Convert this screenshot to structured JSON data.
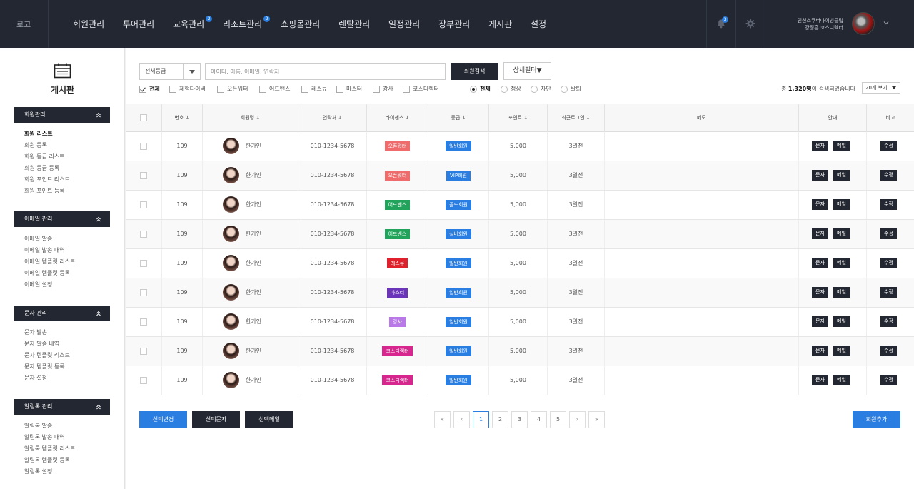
{
  "header": {
    "logo": "로고",
    "nav": [
      {
        "label": "회원관리",
        "badge": ""
      },
      {
        "label": "투어관리",
        "badge": ""
      },
      {
        "label": "교육관리",
        "badge": "2"
      },
      {
        "label": "리조트관리",
        "badge": "2"
      },
      {
        "label": "쇼핑몰관리",
        "badge": ""
      },
      {
        "label": "렌탈관리",
        "badge": ""
      },
      {
        "label": "일정관리",
        "badge": ""
      },
      {
        "label": "장부관리",
        "badge": ""
      },
      {
        "label": "게시판",
        "badge": ""
      },
      {
        "label": "설정",
        "badge": ""
      }
    ],
    "notification_count": "3",
    "profile_line1": "인천스쿠버다이빙클럽",
    "profile_line2": "강정흠 코스디렉터"
  },
  "sidebar": {
    "title": "게시판",
    "sections": [
      {
        "title": "회원관리",
        "items": [
          "회원 리스트",
          "회원 등록",
          "회원 등급 리스트",
          "회원 등급 등록",
          "회원 포인트 리스트",
          "회원 포인트 등록"
        ]
      },
      {
        "title": "이메일 관리",
        "items": [
          "이메일 발송",
          "이메일 발송 내역",
          "이메일 템플릿 리스트",
          "이메일 템플릿 등록",
          "이메일 설정"
        ]
      },
      {
        "title": "문자 관리",
        "items": [
          "문자 발송",
          "문자 발송 내역",
          "문자 템플릿 리스트",
          "문자 템플릿 등록",
          "문자 설정"
        ]
      },
      {
        "title": "알림톡 관리",
        "items": [
          "알림톡 발송",
          "알림톡 발송 내역",
          "알림톡 템플릿 리스트",
          "알림톡 템플릿 등록",
          "알림톡 설정"
        ]
      }
    ]
  },
  "search": {
    "grade_select": "전체등급",
    "placeholder": "아이디, 이름, 이메일, 연락처",
    "search_button": "회원검색",
    "filter_button": "상세필터▼"
  },
  "filters": {
    "licenses": [
      {
        "label": "전체",
        "checked": true
      },
      {
        "label": "체험다이버",
        "checked": false
      },
      {
        "label": "오픈워터",
        "checked": false
      },
      {
        "label": "어드밴스",
        "checked": false
      },
      {
        "label": "레스큐",
        "checked": false
      },
      {
        "label": "마스터",
        "checked": false
      },
      {
        "label": "강사",
        "checked": false
      },
      {
        "label": "코스디렉터",
        "checked": false
      }
    ],
    "statuses": [
      {
        "label": "전체",
        "checked": true
      },
      {
        "label": "정상",
        "checked": false
      },
      {
        "label": "차단",
        "checked": false
      },
      {
        "label": "탈퇴",
        "checked": false
      }
    ]
  },
  "results": {
    "prefix": "총 ",
    "count": "1,320명",
    "suffix": "이 검색되었습니다",
    "page_size": "20개 보기"
  },
  "table": {
    "columns": [
      "번호 ↓",
      "회원명 ↓",
      "연락처 ↓",
      "라이센스 ↓",
      "등급 ↓",
      "포인트 ↓",
      "최근로그인 ↓",
      "메모",
      "안내",
      "비고"
    ],
    "rows": [
      {
        "no": "109",
        "name": "한가인",
        "phone": "010-1234-5678",
        "license": "오픈워터",
        "license_color": "#f06b6b",
        "grade": "일반회원",
        "points": "5,000",
        "last_login": "3일전",
        "memo": ""
      },
      {
        "no": "109",
        "name": "한가인",
        "phone": "010-1234-5678",
        "license": "오픈워터",
        "license_color": "#f06b6b",
        "grade": "VIP회원",
        "points": "5,000",
        "last_login": "3일전",
        "memo": ""
      },
      {
        "no": "109",
        "name": "한가인",
        "phone": "010-1234-5678",
        "license": "어드밴스",
        "license_color": "#22a35c",
        "grade": "골드회원",
        "points": "5,000",
        "last_login": "3일전",
        "memo": ""
      },
      {
        "no": "109",
        "name": "한가인",
        "phone": "010-1234-5678",
        "license": "어드밴스",
        "license_color": "#22a35c",
        "grade": "실버회원",
        "points": "5,000",
        "last_login": "3일전",
        "memo": ""
      },
      {
        "no": "109",
        "name": "한가인",
        "phone": "010-1234-5678",
        "license": "레스큐",
        "license_color": "#e0202a",
        "grade": "일반회원",
        "points": "5,000",
        "last_login": "3일전",
        "memo": ""
      },
      {
        "no": "109",
        "name": "한가인",
        "phone": "010-1234-5678",
        "license": "마스터",
        "license_color": "#6a35b8",
        "grade": "일반회원",
        "points": "5,000",
        "last_login": "3일전",
        "memo": ""
      },
      {
        "no": "109",
        "name": "한가인",
        "phone": "010-1234-5678",
        "license": "강사",
        "license_color": "#b979e8",
        "grade": "일반회원",
        "points": "5,000",
        "last_login": "3일전",
        "memo": ""
      },
      {
        "no": "109",
        "name": "한가인",
        "phone": "010-1234-5678",
        "license": "코스디렉터",
        "license_color": "#d8268f",
        "grade": "일반회원",
        "points": "5,000",
        "last_login": "3일전",
        "memo": ""
      },
      {
        "no": "109",
        "name": "한가인",
        "phone": "010-1234-5678",
        "license": "코스디렉터",
        "license_color": "#d8268f",
        "grade": "일반회원",
        "points": "5,000",
        "last_login": "3일전",
        "memo": ""
      }
    ],
    "grade_color": "#2a7de1",
    "sms_label": "문자",
    "mail_label": "메일",
    "edit_label": "수정"
  },
  "footer": {
    "change_button": "선택변경",
    "sms_button": "선택문자",
    "mail_button": "선택메일",
    "add_button": "회원추가",
    "first_label": "«",
    "prev_label": "‹",
    "next_label": "›",
    "last_label": "»",
    "pages": [
      "1",
      "2",
      "3",
      "4",
      "5"
    ],
    "current_page": "1"
  },
  "colors": {
    "nav_bg": "#232732",
    "accent": "#2a7de1"
  }
}
